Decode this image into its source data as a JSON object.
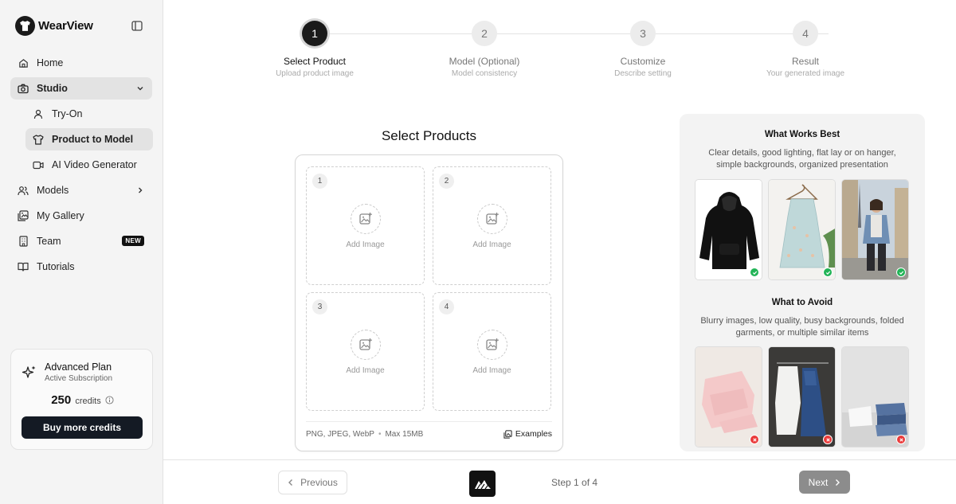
{
  "brand": {
    "name": "WearView"
  },
  "sidebar": {
    "items": [
      {
        "label": "Home",
        "icon": "home-icon"
      },
      {
        "label": "Studio",
        "icon": "camera-icon",
        "expanded": true
      },
      {
        "label": "Try-On",
        "icon": "user-icon"
      },
      {
        "label": "Product to Model",
        "icon": "shirt-icon",
        "selected": true
      },
      {
        "label": "AI Video Generator",
        "icon": "video-icon"
      },
      {
        "label": "Models",
        "icon": "users-icon"
      },
      {
        "label": "My Gallery",
        "icon": "gallery-icon"
      },
      {
        "label": "Team",
        "icon": "building-icon",
        "badge": "NEW"
      },
      {
        "label": "Tutorials",
        "icon": "book-icon"
      }
    ],
    "plan": {
      "name": "Advanced Plan",
      "status": "Active Subscription",
      "credits": "250",
      "credits_label": "credits",
      "buy_label": "Buy more credits"
    }
  },
  "stepper": {
    "steps": [
      {
        "number": "1",
        "title": "Select Product",
        "subtitle": "Upload product image",
        "active": true
      },
      {
        "number": "2",
        "title": "Model (Optional)",
        "subtitle": "Model consistency"
      },
      {
        "number": "3",
        "title": "Customize",
        "subtitle": "Describe setting"
      },
      {
        "number": "4",
        "title": "Result",
        "subtitle": "Your generated image"
      }
    ]
  },
  "upload": {
    "title": "Select Products",
    "slots": [
      {
        "number": "1",
        "label": "Add Image"
      },
      {
        "number": "2",
        "label": "Add Image"
      },
      {
        "number": "3",
        "label": "Add Image"
      },
      {
        "number": "4",
        "label": "Add Image"
      }
    ],
    "formats": "PNG, JPEG, WebP",
    "max_size": "Max 15MB",
    "examples_label": "Examples"
  },
  "tips": {
    "good_title": "What Works Best",
    "good_desc": "Clear details, good lighting, flat lay or on hanger, simple backgrounds, organized presentation",
    "bad_title": "What to Avoid",
    "bad_desc": "Blurry images, low quality, busy backgrounds, folded garments, or multiple similar items"
  },
  "footer": {
    "previous_label": "Previous",
    "step_count": "Step 1 of 4",
    "next_label": "Next"
  },
  "colors": {
    "accent_dark": "#141a24",
    "good": "#22b457",
    "bad": "#ea3a3a"
  }
}
